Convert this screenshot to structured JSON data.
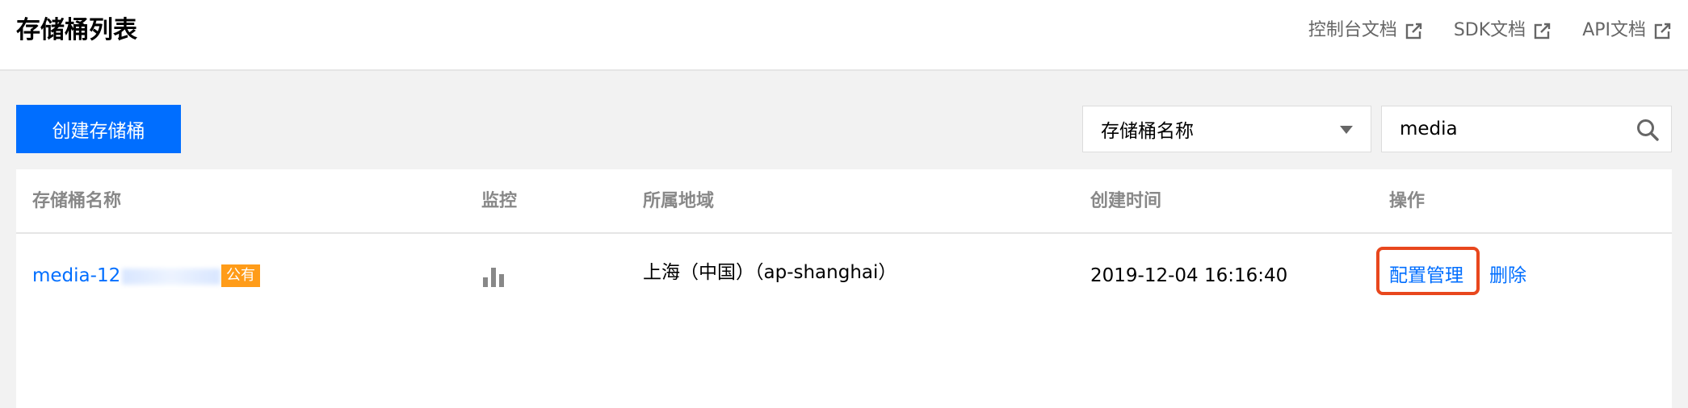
{
  "header": {
    "title": "存储桶列表",
    "links": [
      {
        "label": "控制台文档",
        "icon": "external-link-icon"
      },
      {
        "label": "SDK文档",
        "icon": "external-link-icon"
      },
      {
        "label": "API文档",
        "icon": "external-link-icon"
      }
    ]
  },
  "toolbar": {
    "create_label": "创建存储桶",
    "filter_selected": "存储桶名称",
    "search_value": "media"
  },
  "table": {
    "columns": [
      "存储桶名称",
      "监控",
      "所属地域",
      "创建时间",
      "操作"
    ],
    "rows": [
      {
        "bucket_name_visible_prefix": "media-12",
        "bucket_name_visible_suffix": "6",
        "badge": "公有",
        "monitor_icon": "bar-chart-icon",
        "region": "上海（中国）（ap-shanghai）",
        "created": "2019-12-04 16:16:40",
        "actions": [
          "配置管理",
          "删除"
        ]
      }
    ]
  },
  "colors": {
    "accent": "#006eff",
    "badge": "#ff9c19",
    "highlight": "#e8471d"
  }
}
